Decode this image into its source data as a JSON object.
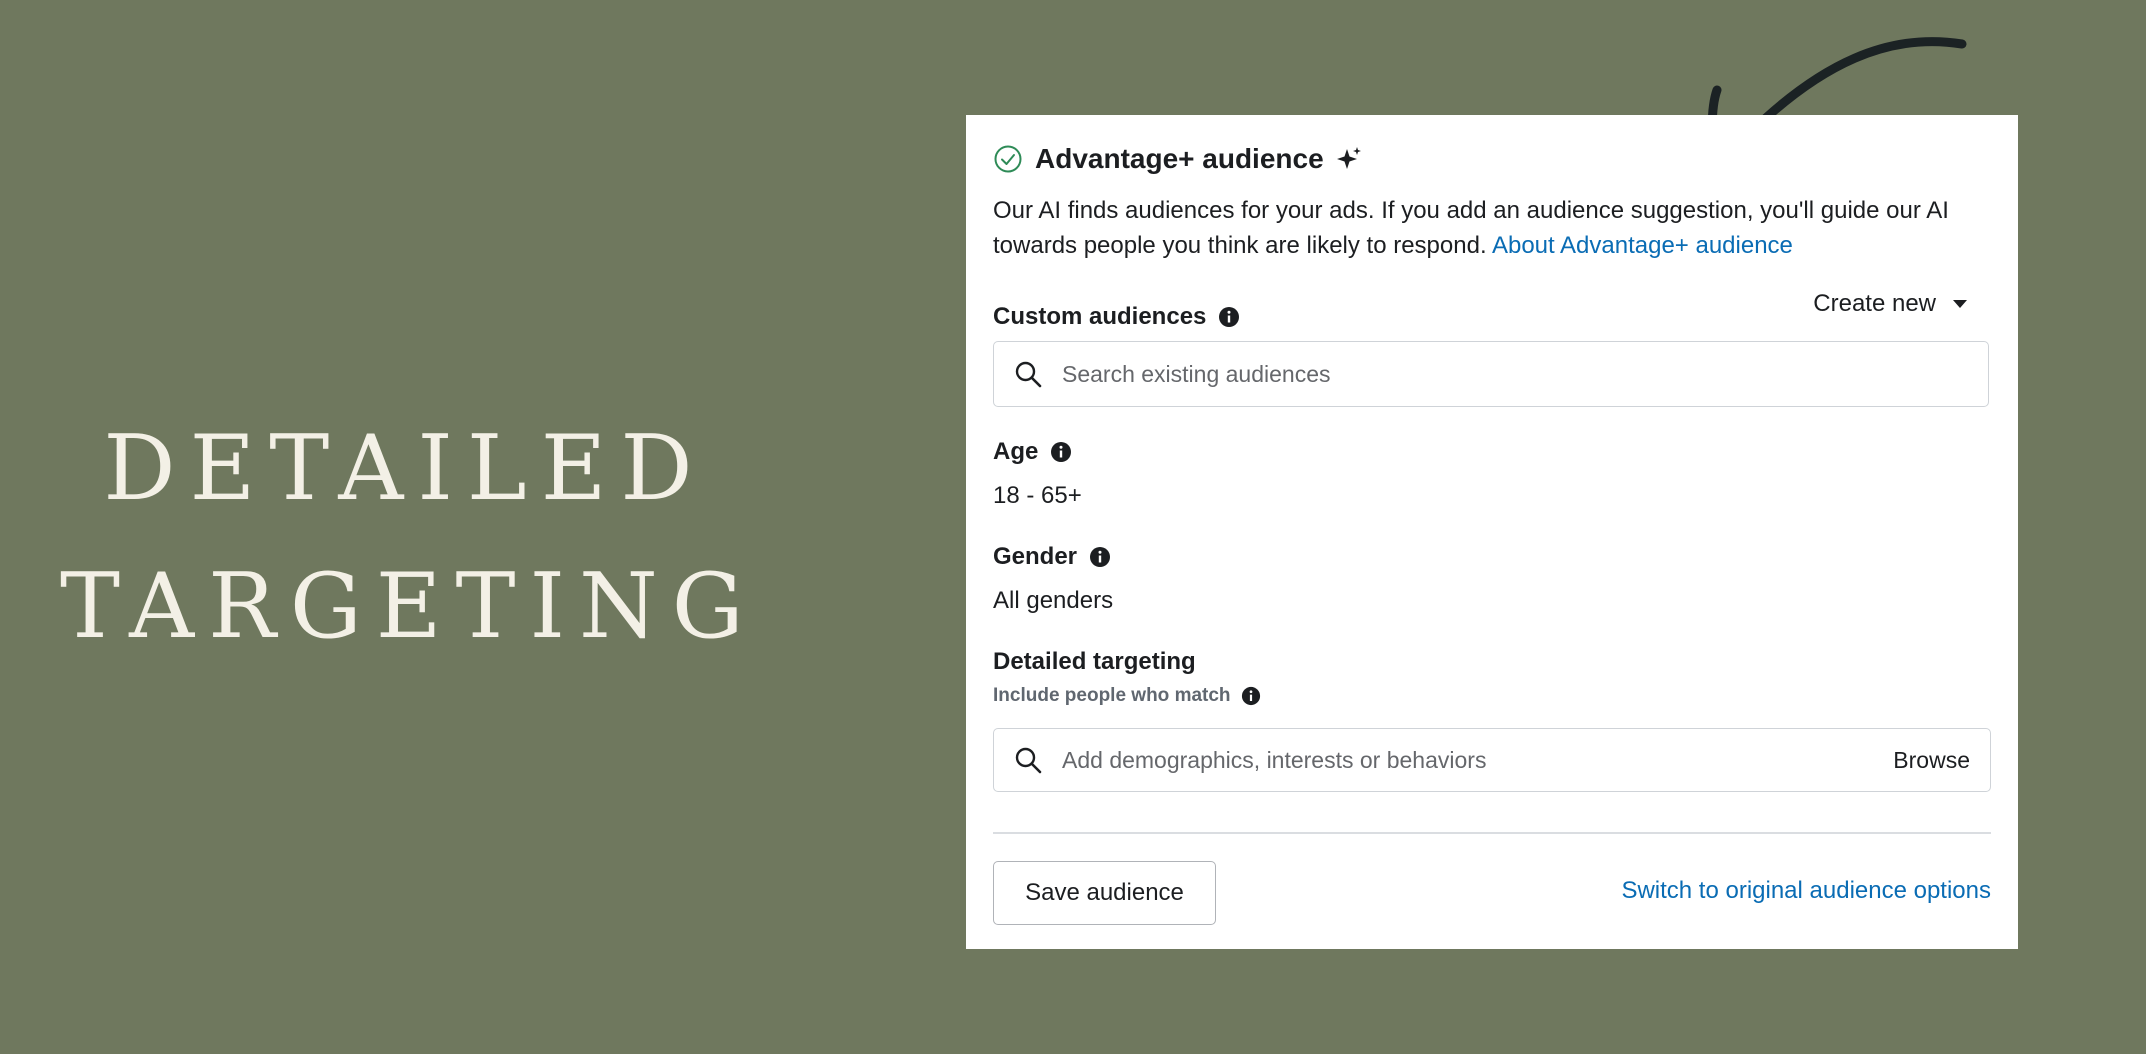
{
  "hero": {
    "line1": "DETAILED",
    "line2": "TARGETING"
  },
  "panel": {
    "title": "Advantage+ audience",
    "description": "Our AI finds audiences for your ads. If you add an audience suggestion, you'll guide our AI towards people you think are likely to respond.",
    "about_link": "About Advantage+ audience",
    "custom_audiences": {
      "label": "Custom audiences",
      "create_new": "Create new",
      "search_placeholder": "Search existing audiences"
    },
    "age": {
      "label": "Age",
      "value": "18 - 65+"
    },
    "gender": {
      "label": "Gender",
      "value": "All genders"
    },
    "detailed_targeting": {
      "label": "Detailed targeting",
      "sublabel": "Include people who match",
      "search_placeholder": "Add demographics, interests or behaviors",
      "browse_label": "Browse"
    },
    "save_label": "Save audience",
    "switch_link": "Switch to original audience options"
  },
  "colors": {
    "background": "#6f785e",
    "link": "#0a6cb4",
    "check": "#2e8b57"
  }
}
